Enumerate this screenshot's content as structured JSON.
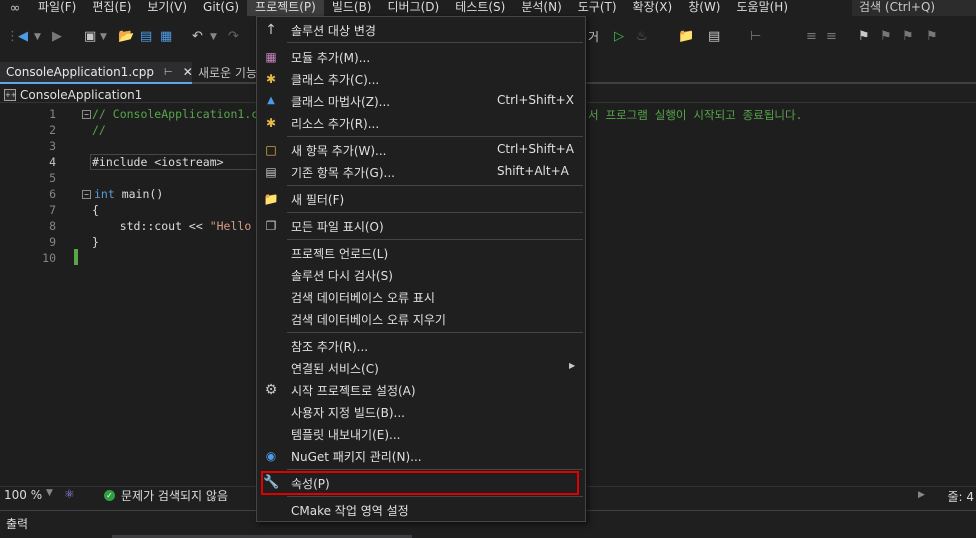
{
  "menubar": {
    "items": [
      {
        "label": "파일(F)"
      },
      {
        "label": "편집(E)"
      },
      {
        "label": "보기(V)"
      },
      {
        "label": "Git(G)"
      },
      {
        "label": "프로젝트(P)"
      },
      {
        "label": "빌드(B)"
      },
      {
        "label": "디버그(D)"
      },
      {
        "label": "테스트(S)"
      },
      {
        "label": "분석(N)"
      },
      {
        "label": "도구(T)"
      },
      {
        "label": "확장(X)"
      },
      {
        "label": "창(W)"
      },
      {
        "label": "도움말(H)"
      }
    ],
    "search": "검색 (Ctrl+Q)"
  },
  "toolbar": {
    "partial_text": "거"
  },
  "tabs": {
    "active": "ConsoleApplication1.cpp",
    "other": "새로운 기능"
  },
  "navbar": {
    "project": "ConsoleApplication1"
  },
  "editor": {
    "line_numbers": [
      "1",
      "2",
      "3",
      "4",
      "5",
      "6",
      "7",
      "8",
      "9",
      "10"
    ],
    "lines": {
      "l1_comment": "// ConsoleApplication1.c",
      "l1_tail": "서 프로그램 실행이 시작되고 종료됩니다.",
      "l2_comment": "//",
      "l4_include": "#include <iostream>",
      "l6_kw": "int",
      "l6_rest": " main()",
      "l7": "{",
      "l8_pre": "    std::cout << ",
      "l8_str": "\"Hello",
      "l9": "}"
    }
  },
  "status": {
    "zoom": "100 %",
    "issues": "문제가 검색되지 않음",
    "position": "줄: 4"
  },
  "output": {
    "title": "출력"
  },
  "project_menu": {
    "items": [
      {
        "icon": "arrow-up-icon",
        "label": "솔루션 대상 변경",
        "shortcut": ""
      },
      {
        "icon": "module-icon",
        "label": "모듈 추가(M)...",
        "shortcut": ""
      },
      {
        "icon": "add-class-icon",
        "label": "클래스 추가(C)...",
        "shortcut": ""
      },
      {
        "icon": "class-wizard-icon",
        "label": "클래스 마법사(Z)...",
        "shortcut": "Ctrl+Shift+X"
      },
      {
        "icon": "resource-icon",
        "label": "리소스 추가(R)...",
        "shortcut": ""
      },
      {
        "icon": "new-item-icon",
        "label": "새 항목 추가(W)...",
        "shortcut": "Ctrl+Shift+A"
      },
      {
        "icon": "existing-item-icon",
        "label": "기존 항목 추가(G)...",
        "shortcut": "Shift+Alt+A"
      },
      {
        "icon": "new-filter-icon",
        "label": "새 필터(F)",
        "shortcut": ""
      },
      {
        "icon": "show-all-files-icon",
        "label": "모든 파일 표시(O)",
        "shortcut": ""
      },
      {
        "icon": "",
        "label": "프로젝트 언로드(L)",
        "shortcut": ""
      },
      {
        "icon": "",
        "label": "솔루션 다시 검사(S)",
        "shortcut": ""
      },
      {
        "icon": "",
        "label": "검색 데이터베이스 오류 표시",
        "shortcut": ""
      },
      {
        "icon": "",
        "label": "검색 데이터베이스 오류 지우기",
        "shortcut": ""
      },
      {
        "icon": "",
        "label": "참조 추가(R)...",
        "shortcut": ""
      },
      {
        "icon": "",
        "label": "연결된 서비스(C)",
        "shortcut": ""
      },
      {
        "icon": "gear-icon",
        "label": "시작 프로젝트로 설정(A)",
        "shortcut": ""
      },
      {
        "icon": "",
        "label": "사용자 지정 빌드(B)...",
        "shortcut": ""
      },
      {
        "icon": "",
        "label": "템플릿 내보내기(E)...",
        "shortcut": ""
      },
      {
        "icon": "nuget-icon",
        "label": "NuGet 패키지 관리(N)...",
        "shortcut": ""
      },
      {
        "icon": "wrench-icon",
        "label": "속성(P)",
        "shortcut": ""
      },
      {
        "icon": "",
        "label": "CMake 작업 영역 설정",
        "shortcut": ""
      }
    ]
  },
  "colors": {
    "accent": "#5ea6ea",
    "highlight": "#e00000",
    "comment": "#57a64a",
    "keyword": "#569cd6",
    "string": "#d69d85"
  }
}
